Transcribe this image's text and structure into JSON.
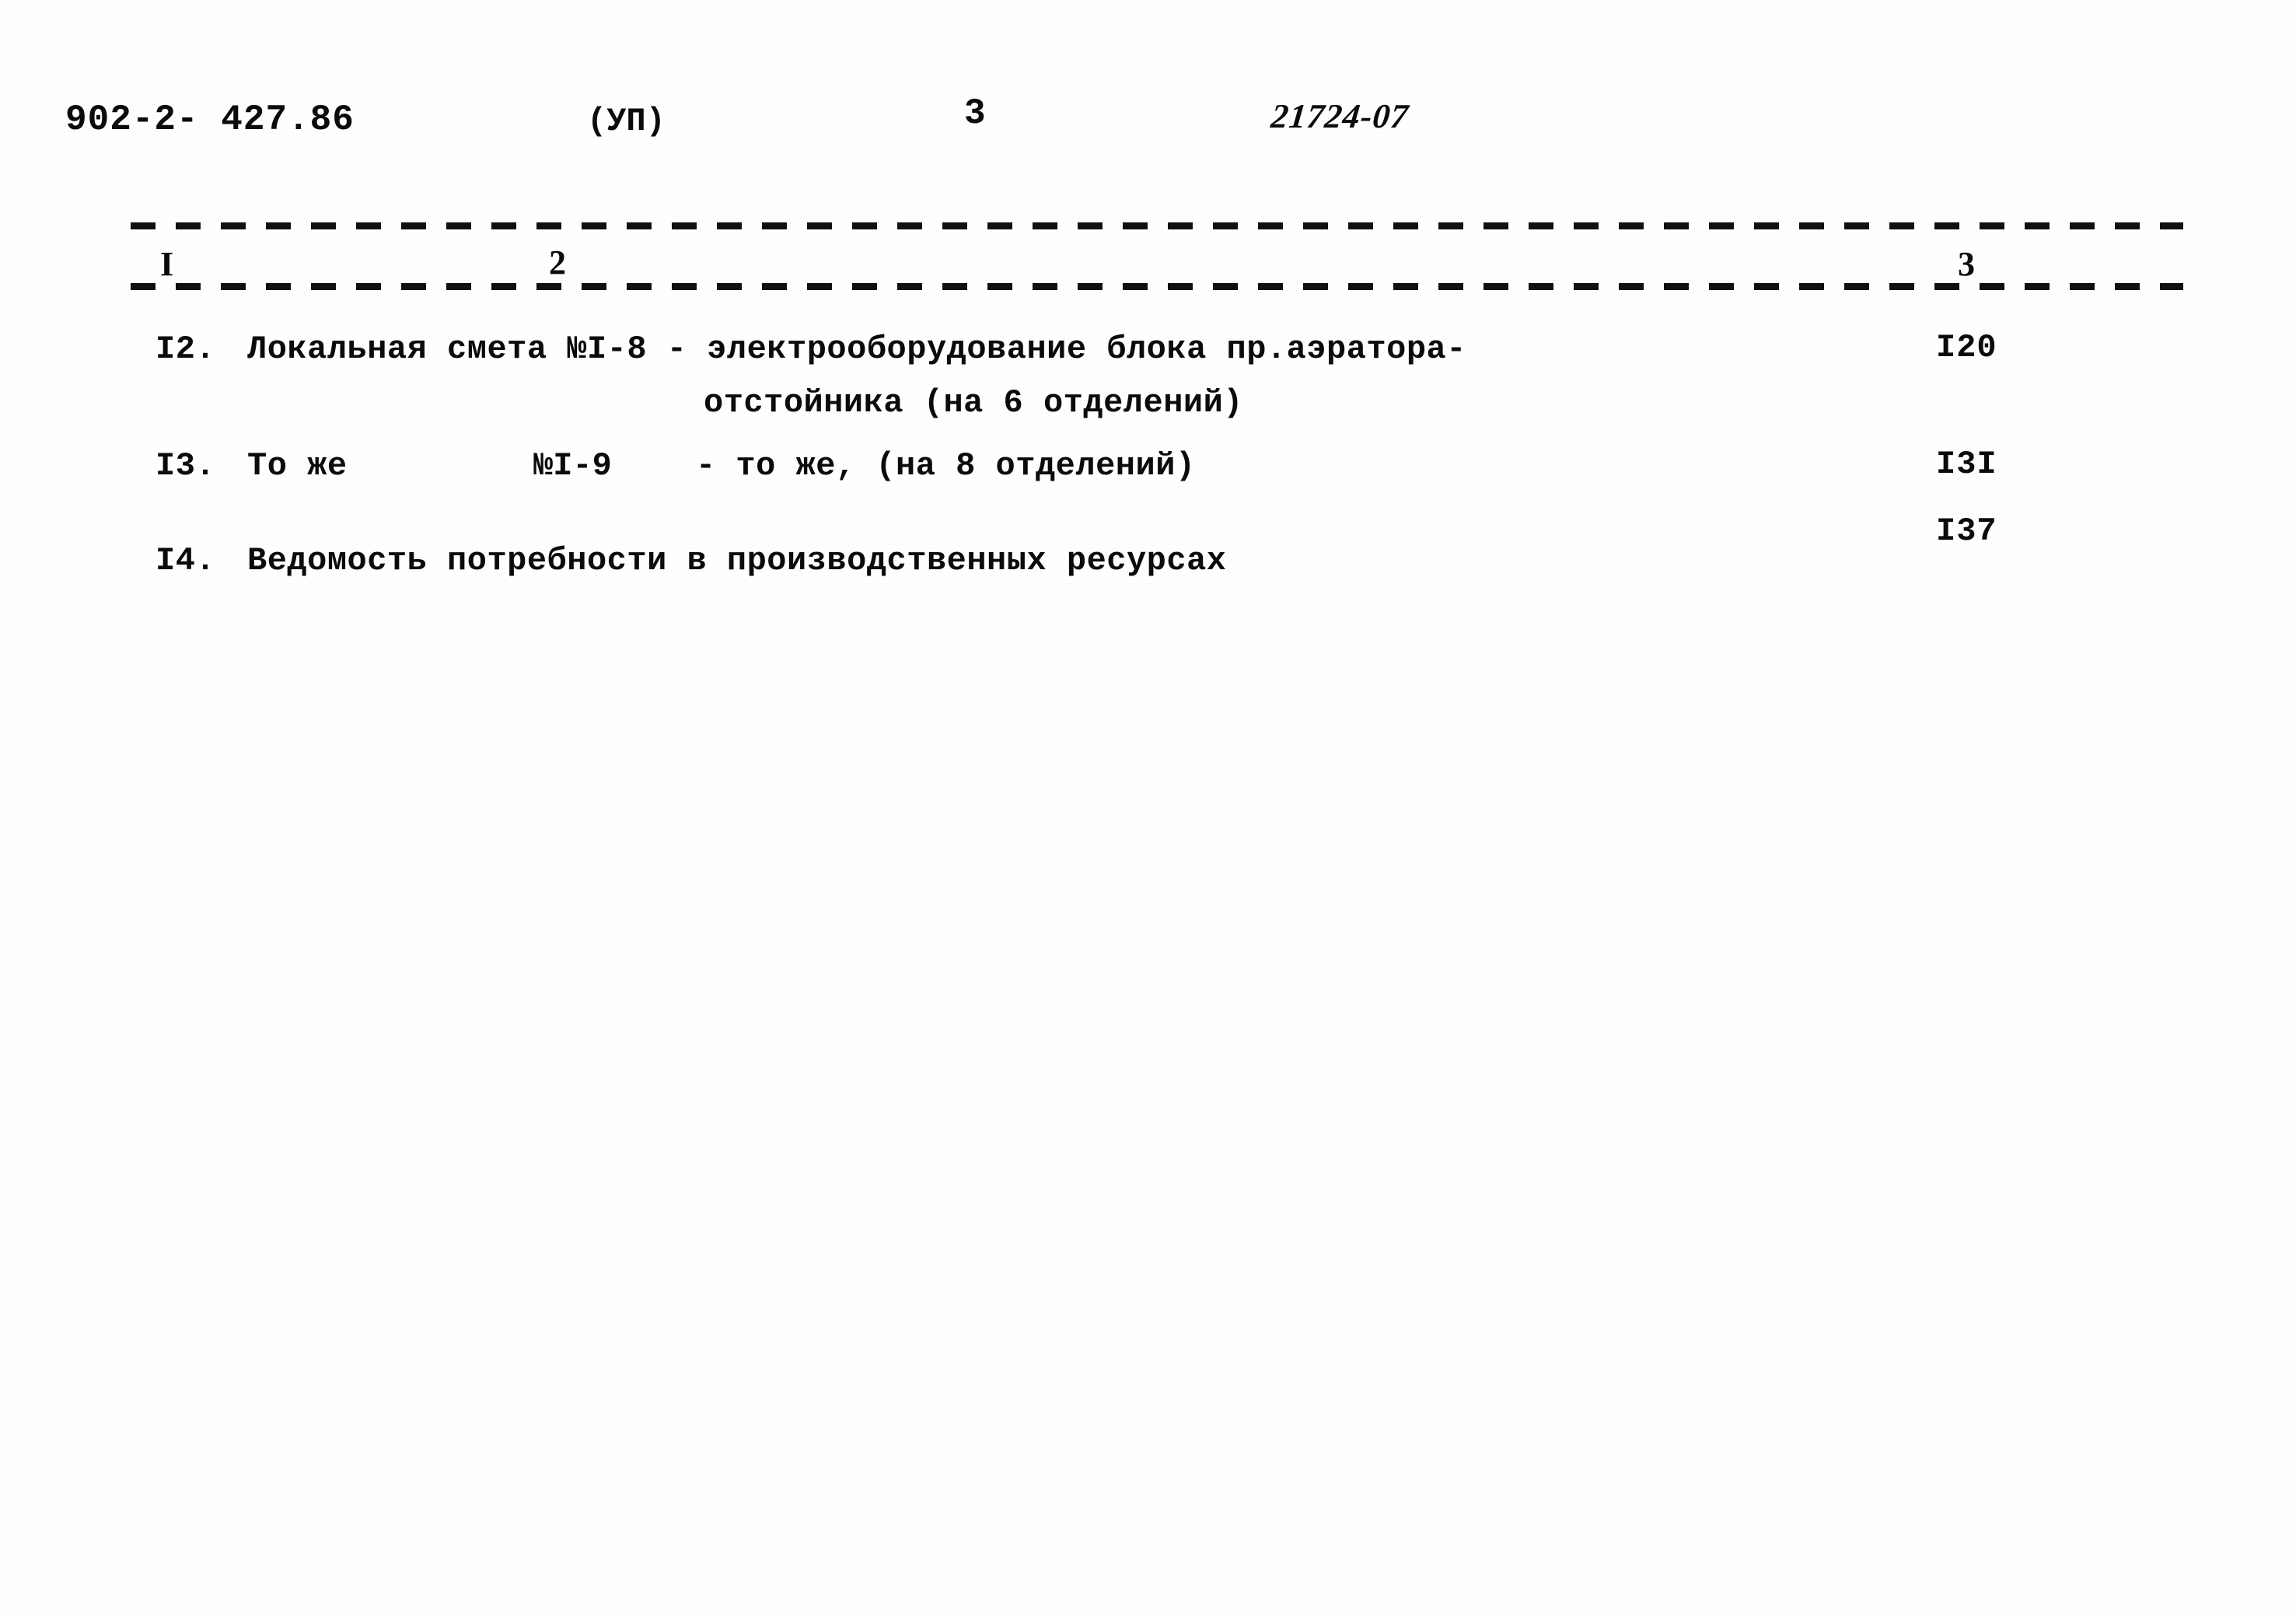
{
  "header": {
    "doc_code": "902-2- 427.86",
    "variant": "(УП)",
    "page_number": "3",
    "archive_number": "21724-07"
  },
  "table": {
    "column_headers": [
      "I",
      "2",
      "3"
    ],
    "rows": [
      {
        "number": "I2.",
        "text_line_1": "Локальная смета №I-8 - электрооборудование блока пр.аэратора-",
        "text_line_2": "отстойника (на 6 отделений)",
        "page": "I20"
      },
      {
        "number": "I3.",
        "text_line_1": "То же",
        "code": "№I-9",
        "text_line_2": "- то же, (на 8 отделений)",
        "page": "I3I"
      },
      {
        "number": "I4.",
        "text_line_1": "Ведомость потребности в производственных ресурсах",
        "page": "I37"
      }
    ]
  }
}
